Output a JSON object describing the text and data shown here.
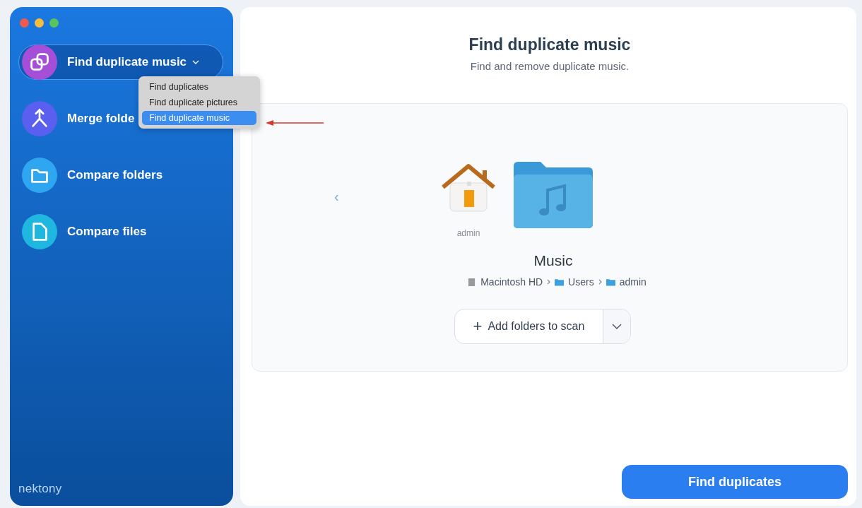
{
  "sidebar": {
    "items": [
      {
        "label": "Find duplicate music",
        "kind": "duplicates",
        "selected": true,
        "has_dropdown": true,
        "color": "#a54fd8"
      },
      {
        "label": "Merge folde",
        "kind": "merge",
        "selected": false,
        "has_dropdown": false,
        "color": "#5b5ff0"
      },
      {
        "label": "Compare folders",
        "kind": "folder",
        "selected": false,
        "has_dropdown": false,
        "color": "#2fa6f0"
      },
      {
        "label": "Compare files",
        "kind": "file",
        "selected": false,
        "has_dropdown": false,
        "color": "#1fb6e0"
      }
    ],
    "brand": "nektony"
  },
  "dropdown_menu": {
    "items": [
      {
        "label": "Find duplicates",
        "selected": false
      },
      {
        "label": "Find duplicate pictures",
        "selected": false
      },
      {
        "label": "Find duplicate music",
        "selected": true
      }
    ]
  },
  "header": {
    "title": "Find duplicate music",
    "subtitle": "Find and remove duplicate music."
  },
  "scan_panel": {
    "back_label": "‹",
    "locations": [
      {
        "kind": "home",
        "label": "admin"
      },
      {
        "kind": "music-folder",
        "label": "Music"
      }
    ],
    "breadcrumb": [
      {
        "kind": "disk",
        "label": "Macintosh HD"
      },
      {
        "kind": "folder",
        "label": "Users"
      },
      {
        "kind": "folder",
        "label": "admin"
      }
    ],
    "add_button": {
      "icon": "+",
      "label": "Add folders to scan"
    }
  },
  "primary_button": "Find duplicates"
}
